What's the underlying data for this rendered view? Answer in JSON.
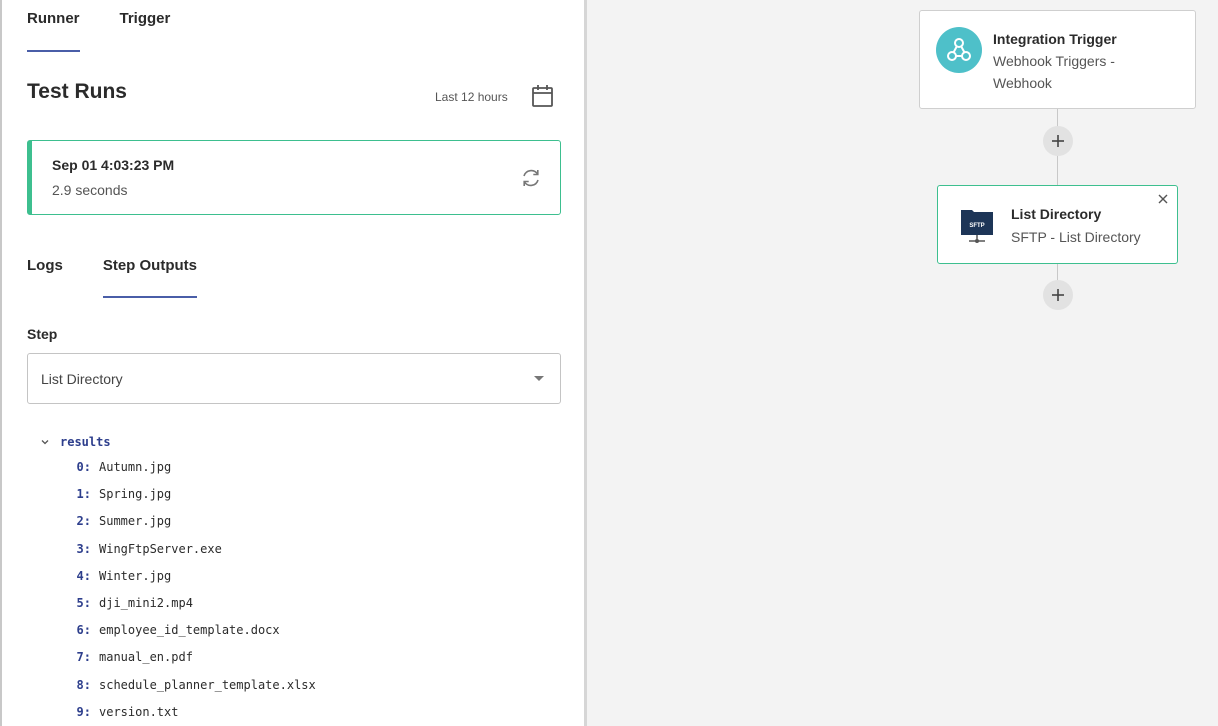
{
  "runner_tabs": [
    {
      "label": "Runner",
      "active": true
    },
    {
      "label": "Trigger",
      "active": false
    }
  ],
  "test_runs": {
    "title": "Test Runs",
    "time_range": "Last 12 hours",
    "run": {
      "date": "Sep 01 4:03:23 PM",
      "duration": "2.9 seconds"
    }
  },
  "output_tabs": [
    {
      "label": "Logs",
      "active": false
    },
    {
      "label": "Step Outputs",
      "active": true
    }
  ],
  "step": {
    "label": "Step",
    "selected": "List Directory"
  },
  "results": {
    "key": "results",
    "items": [
      {
        "index": "0:",
        "value": "Autumn.jpg"
      },
      {
        "index": "1:",
        "value": "Spring.jpg"
      },
      {
        "index": "2:",
        "value": "Summer.jpg"
      },
      {
        "index": "3:",
        "value": "WingFtpServer.exe"
      },
      {
        "index": "4:",
        "value": "Winter.jpg"
      },
      {
        "index": "5:",
        "value": "dji_mini2.mp4"
      },
      {
        "index": "6:",
        "value": "employee_id_template.docx"
      },
      {
        "index": "7:",
        "value": "manual_en.pdf"
      },
      {
        "index": "8:",
        "value": "schedule_planner_template.xlsx"
      },
      {
        "index": "9:",
        "value": "version.txt"
      }
    ]
  },
  "canvas": {
    "trigger_node": {
      "title": "Integration Trigger",
      "subtitle_line1": "Webhook Triggers -",
      "subtitle_line2": "Webhook",
      "icon": "webhook-icon"
    },
    "step_node": {
      "title": "List Directory",
      "subtitle": "SFTP - List Directory",
      "icon": "sftp-icon",
      "icon_text": "SFTP"
    }
  },
  "colors": {
    "accent": "#4a5ea8",
    "success": "#3dbf8f",
    "webhook": "#4ec0c9",
    "sftp": "#1d3557"
  }
}
